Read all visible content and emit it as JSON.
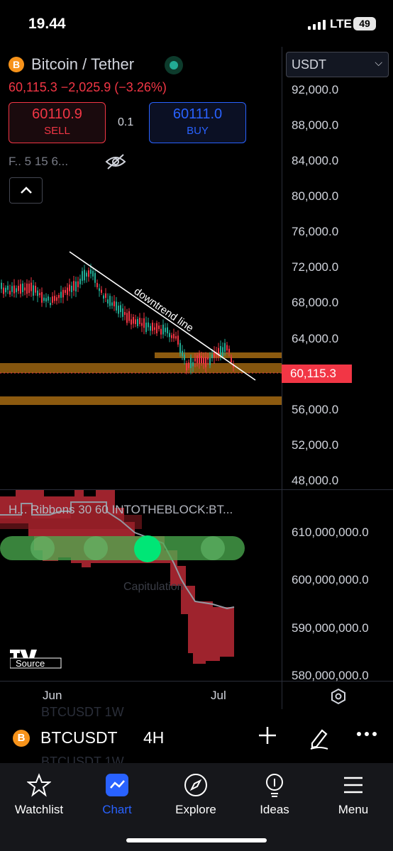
{
  "status_bar": {
    "time": "19.44",
    "network": "LTE",
    "battery": "49"
  },
  "header": {
    "symbol_icon": "B",
    "symbol_name": "Bitcoin / Tether",
    "price_change": "60,115.3 −2,025.9 (−3.26%)",
    "currency": "USDT"
  },
  "trade": {
    "sell_price": "60110.9",
    "sell_label": "SELL",
    "spread": "0.1",
    "buy_price": "60111.0",
    "buy_label": "BUY"
  },
  "indicators_text": "F.. 5 15 6...",
  "price_axis": [
    "92,000.0",
    "88,000.0",
    "84,000.0",
    "80,000.0",
    "76,000.0",
    "72,000.0",
    "68,000.0",
    "64,000.0",
    "60,115.3",
    "56,000.0",
    "52,000.0",
    "48,000.0"
  ],
  "current_price_tag": "60,115.3",
  "annotation": "downtrend line",
  "lower_pane": {
    "legend": "H... Ribbons 30 60 INTOTHEBLOCK:BT...",
    "axis": [
      "610,000,000.0",
      "600,000,000.0",
      "590,000,000.0",
      "580,000,000.0"
    ],
    "watermark": "Capitulation",
    "logo_text": "Source"
  },
  "time_axis": [
    "Jun",
    "Jul"
  ],
  "symbol_bar": {
    "ghost_1": "BTCUSDT     1W",
    "ghost_2": "BTCUSDT     1W",
    "symbol": "BTCUSDT",
    "timeframe": "4H"
  },
  "nav": [
    {
      "label": "Watchlist",
      "icon": "star-icon"
    },
    {
      "label": "Chart",
      "icon": "chart-icon",
      "active": true
    },
    {
      "label": "Explore",
      "icon": "compass-icon"
    },
    {
      "label": "Ideas",
      "icon": "lightbulb-icon"
    },
    {
      "label": "Menu",
      "icon": "menu-icon"
    }
  ],
  "colors": {
    "up": "#22ab94",
    "down": "#f23645",
    "accent": "#2962ff",
    "zone": "#a56a12"
  }
}
